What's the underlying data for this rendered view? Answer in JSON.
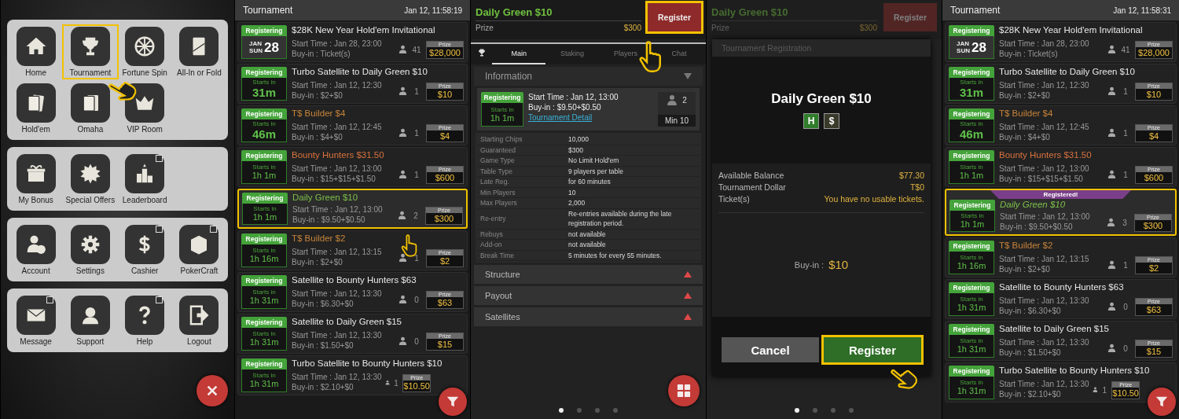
{
  "menu_screen": {
    "groups": [
      {
        "items": [
          {
            "label": "Home",
            "highlighted": false,
            "external": false
          },
          {
            "label": "Tournament",
            "highlighted": true,
            "external": false
          },
          {
            "label": "Fortune Spin",
            "highlighted": false,
            "external": false
          },
          {
            "label": "All-In or Fold",
            "highlighted": false,
            "external": false
          },
          {
            "label": "Hold'em",
            "highlighted": false,
            "external": false
          },
          {
            "label": "Omaha",
            "highlighted": false,
            "external": false
          },
          {
            "label": "VIP Room",
            "highlighted": false,
            "external": false
          }
        ]
      },
      {
        "items": [
          {
            "label": "My Bonus",
            "highlighted": false,
            "external": false
          },
          {
            "label": "Special Offers",
            "highlighted": false,
            "external": false
          },
          {
            "label": "Leaderboard",
            "highlighted": false,
            "external": true
          }
        ]
      },
      {
        "items": [
          {
            "label": "Account",
            "highlighted": false,
            "external": false
          },
          {
            "label": "Settings",
            "highlighted": false,
            "external": false
          },
          {
            "label": "Cashier",
            "highlighted": false,
            "external": true
          },
          {
            "label": "PokerCraft",
            "highlighted": false,
            "external": true
          }
        ]
      },
      {
        "items": [
          {
            "label": "Message",
            "highlighted": false,
            "external": true
          },
          {
            "label": "Support",
            "highlighted": false,
            "external": false
          },
          {
            "label": "Help",
            "highlighted": false,
            "external": true
          },
          {
            "label": "Logout",
            "highlighted": false,
            "external": false
          }
        ]
      }
    ]
  },
  "lobby_screen": {
    "title": "Tournament",
    "time": "Jan 12, 11:58:19",
    "rows": [
      {
        "kind": "date",
        "status": "Registering",
        "month": "JAN",
        "weekday": "SUN",
        "day": "28",
        "name": "$28K New Year Hold'em Invitational",
        "color": "#e8e8e8",
        "start": "Start Time : Jan 28, 23:00",
        "buyin": "Buy-in : Ticket(s)",
        "players": "41",
        "prize_label": "Prize",
        "prize": "$28,000",
        "highlighted": false
      },
      {
        "kind": "countdown",
        "status": "Registering",
        "starts_label": "Starts in",
        "countdown": "31m",
        "big": true,
        "name": "Turbo Satellite to Daily Green $10",
        "color": "#e8e8e8",
        "start": "Start Time : Jan 12, 12:30",
        "buyin": "Buy-in : $2+$0",
        "players": "1",
        "prize_label": "Prize",
        "prize": "$10",
        "highlighted": false
      },
      {
        "kind": "countdown",
        "status": "Registering",
        "starts_label": "Starts in",
        "countdown": "46m",
        "big": true,
        "name": "T$ Builder $4",
        "color": "#c8843a",
        "start": "Start Time : Jan 12, 12:45",
        "buyin": "Buy-in : $4+$0",
        "players": "1",
        "prize_label": "Prize",
        "prize": "$4",
        "highlighted": false
      },
      {
        "kind": "countdown",
        "status": "Registering",
        "starts_label": "Starts in",
        "countdown": "1h 1m",
        "big": false,
        "name": "Bounty Hunters $31.50",
        "color": "#d9733f",
        "start": "Start Time : Jan 12, 13:00",
        "buyin": "Buy-in : $15+$15+$1.50",
        "players": "1",
        "prize_label": "Prize",
        "prize": "$600",
        "highlighted": false
      },
      {
        "kind": "countdown",
        "status": "Registering",
        "starts_label": "Starts in",
        "countdown": "1h 1m",
        "big": false,
        "name": "Daily Green $10",
        "color": "#7cc04a",
        "start": "Start Time : Jan 12, 13:00",
        "buyin": "Buy-in : $9.50+$0.50",
        "players": "2",
        "prize_label": "Prize",
        "prize": "$300",
        "highlighted": true
      },
      {
        "kind": "countdown",
        "status": "Registering",
        "starts_label": "Starts in",
        "countdown": "1h 16m",
        "big": false,
        "name": "T$ Builder $2",
        "color": "#c8843a",
        "start": "Start Time : Jan 12, 13:15",
        "buyin": "Buy-in : $2+$0",
        "players": "1",
        "prize_label": "Prize",
        "prize": "$2",
        "highlighted": false
      },
      {
        "kind": "countdown",
        "status": "Registering",
        "starts_label": "Starts in",
        "countdown": "1h 31m",
        "big": false,
        "name": "Satellite to Bounty Hunters $63",
        "color": "#e8e8e8",
        "start": "Start Time : Jan 12, 13:30",
        "buyin": "Buy-in : $6.30+$0",
        "players": "0",
        "prize_label": "Prize",
        "prize": "$63",
        "highlighted": false
      },
      {
        "kind": "countdown",
        "status": "Registering",
        "starts_label": "Starts in",
        "countdown": "1h 31m",
        "big": false,
        "name": "Satellite to Daily Green $15",
        "color": "#e8e8e8",
        "start": "Start Time : Jan 12, 13:30",
        "buyin": "Buy-in : $1.50+$0",
        "players": "0",
        "prize_label": "Prize",
        "prize": "$15",
        "highlighted": false
      },
      {
        "kind": "countdown",
        "status": "Registering",
        "starts_label": "Starts in",
        "countdown": "1h 31m",
        "big": false,
        "name": "Turbo Satellite to Bounty Hunters $10",
        "color": "#e8e8e8",
        "start": "Start Time : Jan 12, 13:30",
        "buyin": "Buy-in : $2.10+$0",
        "players": "1",
        "prize_label": "Prize",
        "prize": "$10.50",
        "highlighted": false
      }
    ]
  },
  "detail_screen": {
    "title": "Daily Green $10",
    "prize_label": "Prize",
    "prize": "$300",
    "register_button": "Register",
    "register_highlighted": true,
    "tabs": [
      {
        "kind": "icon",
        "selected": false
      },
      {
        "kind": "text",
        "label": "Main",
        "selected": true
      },
      {
        "kind": "text",
        "label": "Staking",
        "selected": false
      },
      {
        "kind": "text",
        "label": "Players",
        "selected": false
      },
      {
        "kind": "text",
        "label": "Chat",
        "selected": false
      }
    ],
    "info_title": "Information",
    "info_expanded": true,
    "card": {
      "status": "Registering",
      "starts_label": "Starts in",
      "countdown": "1h 1m",
      "start": "Start Time : Jan 12, 13:00",
      "buyin": "Buy-in : $9.50+$0.50",
      "link": "Tournament Detail",
      "players": "2",
      "min": "Min 10"
    },
    "details": [
      {
        "label": "Starting Chips",
        "value": "10,000"
      },
      {
        "label": "Guaranteed",
        "value": "$300"
      },
      {
        "label": "Game Type",
        "value": "No Limit Hold'em"
      },
      {
        "label": "Table Type",
        "value": "9 players per table"
      },
      {
        "label": "Late Reg.",
        "value": "for 60 minutes"
      },
      {
        "label": "Min Players",
        "value": "10"
      },
      {
        "label": "Max Players",
        "value": "2,000"
      },
      {
        "label": "Re-entry",
        "value": "Re-entries available during the late registration period."
      },
      {
        "label": "Rebuys",
        "value": "not available"
      },
      {
        "label": "Add-on",
        "value": "not available"
      },
      {
        "label": "Break Time",
        "value": "5 minutes for every 55 minutes."
      }
    ],
    "sections": [
      {
        "title": "Structure",
        "expanded": false
      },
      {
        "title": "Payout",
        "expanded": false
      },
      {
        "title": "Satellites",
        "expanded": false
      }
    ],
    "pages": [
      {
        "selected": true
      },
      {
        "selected": false
      },
      {
        "selected": false
      },
      {
        "selected": false
      }
    ]
  },
  "registration_screen": {
    "title": "Daily Green $10",
    "prize_label": "Prize",
    "prize": "$300",
    "register_button": "Register",
    "dialog": {
      "title": "Tournament Registration",
      "heading": "Daily Green $10",
      "badges": [
        {
          "text": "H",
          "color": "#2f7d2a"
        },
        {
          "text": "$",
          "color": "#3a3a2a"
        }
      ],
      "balances": [
        {
          "label": "Available Balance",
          "value": "$77.30"
        },
        {
          "label": "Tournament Dollar",
          "value": "T$0"
        },
        {
          "label": "Ticket(s)",
          "value": "You have no usable tickets."
        }
      ],
      "buyin_label": "Buy-in :",
      "buyin": "$10",
      "cancel": "Cancel",
      "register": "Register",
      "register_highlighted": true
    },
    "pages": [
      {
        "selected": true
      },
      {
        "selected": false
      },
      {
        "selected": false
      },
      {
        "selected": false
      }
    ]
  },
  "lobby_screen_after": {
    "title": "Tournament",
    "time": "Jan 12, 11:58:31",
    "rows": [
      {
        "kind": "date",
        "status": "Registering",
        "month": "JAN",
        "weekday": "SUN",
        "day": "28",
        "name": "$28K New Year Hold'em Invitational",
        "color": "#e8e8e8",
        "start": "Start Time : Jan 28, 23:00",
        "buyin": "Buy-in : Ticket(s)",
        "players": "41",
        "prize_label": "Prize",
        "prize": "$28,000",
        "highlighted": false
      },
      {
        "kind": "countdown",
        "status": "Registering",
        "starts_label": "Starts in",
        "countdown": "31m",
        "big": true,
        "name": "Turbo Satellite to Daily Green $10",
        "color": "#e8e8e8",
        "start": "Start Time : Jan 12, 12:30",
        "buyin": "Buy-in : $2+$0",
        "players": "1",
        "prize_label": "Prize",
        "prize": "$10",
        "highlighted": false
      },
      {
        "kind": "countdown",
        "status": "Registering",
        "starts_label": "Starts in",
        "countdown": "46m",
        "big": true,
        "name": "T$ Builder $4",
        "color": "#c8843a",
        "start": "Start Time : Jan 12, 12:45",
        "buyin": "Buy-in : $4+$0",
        "players": "1",
        "prize_label": "Prize",
        "prize": "$4",
        "highlighted": false
      },
      {
        "kind": "countdown",
        "status": "Registering",
        "starts_label": "Starts in",
        "countdown": "1h 1m",
        "big": false,
        "name": "Bounty Hunters $31.50",
        "color": "#d9733f",
        "start": "Start Time : Jan 12, 13:00",
        "buyin": "Buy-in : $15+$15+$1.50",
        "players": "1",
        "prize_label": "Prize",
        "prize": "$600",
        "highlighted": false
      },
      {
        "kind": "countdown",
        "status": "Registering",
        "starts_label": "Starts in",
        "countdown": "1h 1m",
        "big": false,
        "name": "Daily Green $10",
        "color": "#7cc04a",
        "start": "Start Time : Jan 12, 13:00",
        "buyin": "Buy-in : $9.50+$0.50",
        "players": "3",
        "prize_label": "Prize",
        "prize": "$300",
        "highlighted": true,
        "banner": "Registered!"
      },
      {
        "kind": "countdown",
        "status": "Registering",
        "starts_label": "Starts in",
        "countdown": "1h 16m",
        "big": false,
        "name": "T$ Builder $2",
        "color": "#c8843a",
        "start": "Start Time : Jan 12, 13:15",
        "buyin": "Buy-in : $2+$0",
        "players": "1",
        "prize_label": "Prize",
        "prize": "$2",
        "highlighted": false
      },
      {
        "kind": "countdown",
        "status": "Registering",
        "starts_label": "Starts in",
        "countdown": "1h 31m",
        "big": false,
        "name": "Satellite to Bounty Hunters $63",
        "color": "#e8e8e8",
        "start": "Start Time : Jan 12, 13:30",
        "buyin": "Buy-in : $6.30+$0",
        "players": "0",
        "prize_label": "Prize",
        "prize": "$63",
        "highlighted": false
      },
      {
        "kind": "countdown",
        "status": "Registering",
        "starts_label": "Starts in",
        "countdown": "1h 31m",
        "big": false,
        "name": "Satellite to Daily Green $15",
        "color": "#e8e8e8",
        "start": "Start Time : Jan 12, 13:30",
        "buyin": "Buy-in : $1.50+$0",
        "players": "0",
        "prize_label": "Prize",
        "prize": "$15",
        "highlighted": false
      },
      {
        "kind": "countdown",
        "status": "Registering",
        "starts_label": "Starts in",
        "countdown": "1h 31m",
        "big": false,
        "name": "Turbo Satellite to Bounty Hunters $10",
        "color": "#e8e8e8",
        "start": "Start Time : Jan 12, 13:30",
        "buyin": "Buy-in : $2.10+$0",
        "players": "1",
        "prize_label": "Prize",
        "prize": "$10.50",
        "highlighted": false
      }
    ]
  }
}
